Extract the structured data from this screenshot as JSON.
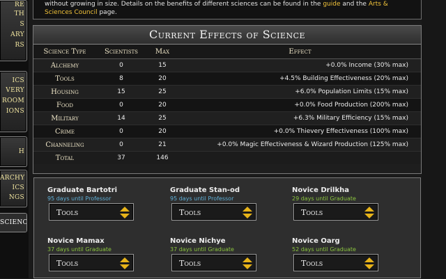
{
  "nav": {
    "block1": [
      "RE",
      "TH",
      "S",
      "ARY",
      "RS"
    ],
    "block2": [
      "ICS",
      "VERY",
      "ROOM",
      "",
      "IONS"
    ],
    "block3": [
      "H"
    ],
    "block4": [
      "ARCHY",
      "ICS",
      "NGS"
    ],
    "block5": [
      "SCIENCES"
    ]
  },
  "intro": {
    "text_start": "without growing in size. Details on the benefits of different sciences can be found in the",
    "guide_link": "guide",
    "text_mid": "and the",
    "council_link_a": "Arts &",
    "council_link_b": "Sciences Council",
    "text_end": "page."
  },
  "panel": {
    "title": "Current Effects of Science",
    "headers": {
      "type": "Science Type",
      "scientists": "Scientists",
      "max": "Max",
      "effect": "Effect"
    },
    "rows": [
      {
        "type": "Alchemy",
        "scientists": "0",
        "max": "15",
        "effect": "+0.0% Income (30% max)"
      },
      {
        "type": "Tools",
        "scientists": "8",
        "max": "20",
        "effect": "+4.5% Building Effectiveness (20% max)"
      },
      {
        "type": "Housing",
        "scientists": "15",
        "max": "25",
        "effect": "+6.0% Population Limits (15% max)"
      },
      {
        "type": "Food",
        "scientists": "0",
        "max": "20",
        "effect": "+0.0% Food Production (200% max)"
      },
      {
        "type": "Military",
        "scientists": "14",
        "max": "25",
        "effect": "+6.3% Military Efficiency (15% max)"
      },
      {
        "type": "Crime",
        "scientists": "0",
        "max": "20",
        "effect": "+0.0% Thievery Effectiveness (100% max)"
      },
      {
        "type": "Channeling",
        "scientists": "0",
        "max": "21",
        "effect": "+0.0% Magic Effectiveness & Wizard Production (125% max)"
      }
    ],
    "total": {
      "type": "Total",
      "scientists": "37",
      "max": "146",
      "effect": ""
    }
  },
  "scientists": [
    {
      "name": "Graduate Bartotri",
      "days": "95 days until Professor",
      "days_color": "#5fb0d8",
      "assignment": "Tools"
    },
    {
      "name": "Graduate Stan-od",
      "days": "95 days until Professor",
      "days_color": "#5fb0d8",
      "assignment": "Tools"
    },
    {
      "name": "Novice Drilkha",
      "days": "29 days until Graduate",
      "days_color": "#8cc63f",
      "assignment": "Tools"
    },
    {
      "name": "Novice Mamax",
      "days": "37 days until Graduate",
      "days_color": "#8cc63f",
      "assignment": "Tools"
    },
    {
      "name": "Novice Nichye",
      "days": "37 days until Graduate",
      "days_color": "#8cc63f",
      "assignment": "Tools"
    },
    {
      "name": "Novice Oarg",
      "days": "52 days until Graduate",
      "days_color": "#8cc63f",
      "assignment": "Tools"
    }
  ],
  "colors": {
    "link": "#f0c23a",
    "arrow": "#e7b319",
    "professor": "#5fb0d8",
    "graduate": "#8cc63f"
  }
}
